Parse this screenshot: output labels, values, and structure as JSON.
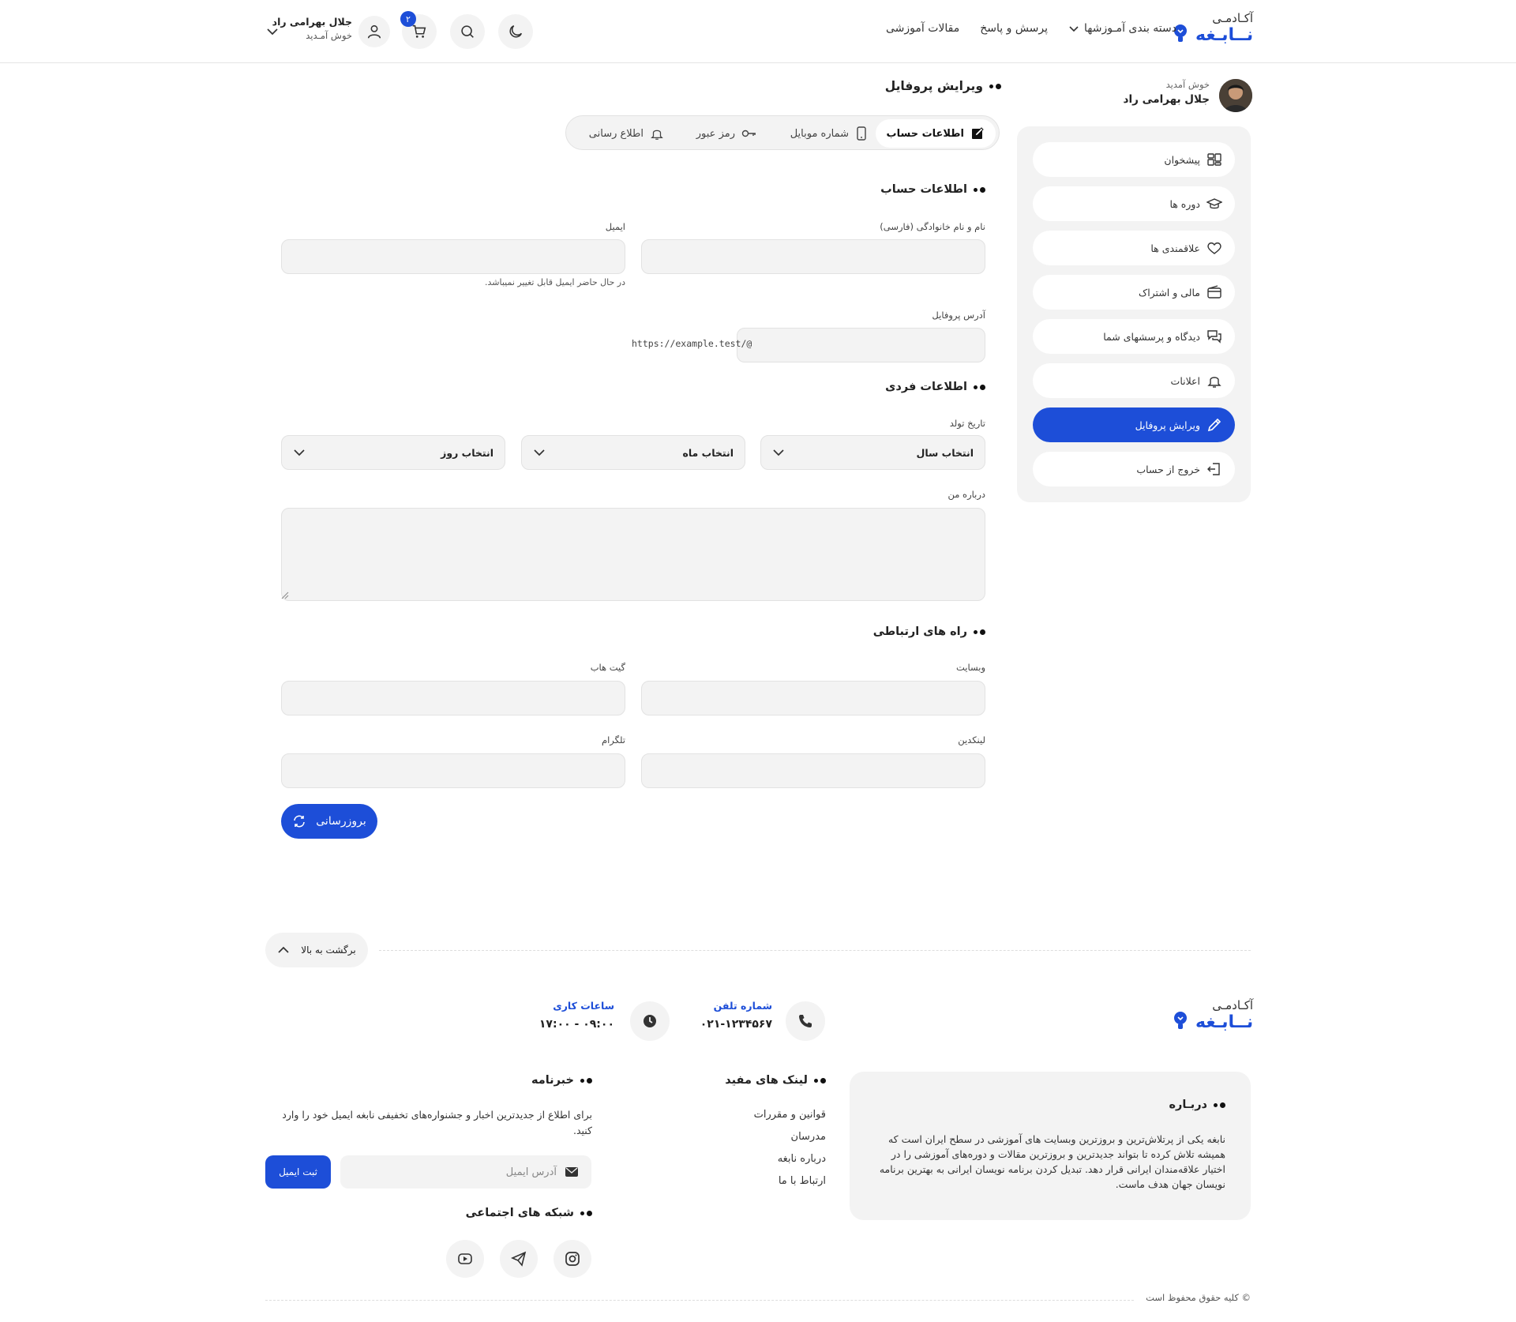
{
  "header": {
    "logo_top": "آکـادمـی",
    "logo_bottom": "نــابـغه",
    "nav": [
      "دسته بندی آمـوزشها",
      "پرسش و پاسخ",
      "مقالات آموزشی"
    ],
    "cart_count": "۲",
    "user_name": "جلال بهرامی راد",
    "user_welcome": "خوش آمـدید"
  },
  "sidebar": {
    "welcome": "خوش آمدید",
    "user_name": "جلال بهرامی راد",
    "items": [
      {
        "label": "پیشخوان",
        "icon": "dashboard-icon"
      },
      {
        "label": "دوره ها",
        "icon": "graduation-cap-icon"
      },
      {
        "label": "علاقمندی ها",
        "icon": "heart-icon"
      },
      {
        "label": "مالی و اشتراک",
        "icon": "wallet-icon"
      },
      {
        "label": "دیدگاه و پرسشهای شما",
        "icon": "comments-icon"
      },
      {
        "label": "اعلانات",
        "icon": "bell-icon"
      },
      {
        "label": "ویرایش پروفایل",
        "icon": "pencil-icon"
      },
      {
        "label": "خروج از حساب",
        "icon": "logout-icon"
      }
    ],
    "active_index": 6
  },
  "main": {
    "title": "ویرایش پروفایل",
    "tabs": [
      {
        "label": "اطلاعات حساب",
        "icon": "edit-square-icon"
      },
      {
        "label": "شماره موبایل",
        "icon": "mobile-icon"
      },
      {
        "label": "رمز عبور",
        "icon": "key-icon"
      },
      {
        "label": "اطلاع رسانی",
        "icon": "bell-icon"
      }
    ],
    "account_section": "اطلاعات حساب",
    "name_label": "نام و نام خانوادگی (فارسی)",
    "name_value": "",
    "email_label": "ایمیل",
    "email_value": "",
    "email_hint": "در حال حاضر ایمیل قابل تغییر نمیباشد.",
    "profile_url_label": "آدرس پروفایل",
    "profile_url_prefix": "https://example.test/@",
    "profile_url_value": "",
    "personal_section": "اطلاعات فردی",
    "birth_label": "تاریخ تولد",
    "year_select": "انتخاب سال",
    "month_select": "انتخاب ماه",
    "day_select": "انتخاب روز",
    "about_label": "درباره من",
    "about_value": "",
    "contact_section": "راه های ارتباطی",
    "website_label": "وبسایت",
    "github_label": "گیت هاب",
    "linkedin_label": "لینکدین",
    "telegram_label": "تلگرام",
    "update_button": "بروزرسانی"
  },
  "footer": {
    "back_to_top": "برگشت به بالا",
    "logo_top": "آکـادمـی",
    "logo_bottom": "نــابـغه",
    "phone_title": "شماره تلفن",
    "phone_value": "۰۲۱-۱۲۳۴۵۶۷",
    "hours_title": "ساعات کاری",
    "hours_value": "۰۹:۰۰ - ۱۷:۰۰",
    "about_title": "دربـاره",
    "about_text": "نابغه یکی از پرتلاش‌ترین و بروزترین وبسایت های آموزشی در سطح ایران است که همیشه تلاش کرده تا بتواند جدیدترین و بروزترین مقالات و دوره‌های آموزشی را در اختیار علاقه‌مندان ایرانی قرار دهد. تبدیل کردن برنامه نویسان ایرانی به بهترین برنامه نویسان جهان هدف ماست.",
    "links_title": "لینک های مفید",
    "links": [
      "قوانین و مقررات",
      "مدرسان",
      "درباره نابغه",
      "ارتباط با ما"
    ],
    "newsletter_title": "خبرنامه",
    "newsletter_text": "برای اطلاع از جدیدترین اخبار و جشنواره‌های تخفیفی نابغه ایمیل خود را وارد کنید.",
    "newsletter_placeholder": "آدرس ایمیل",
    "newsletter_button": "ثبت ایمیل",
    "social_title": "شبکه های اجتماعی",
    "copyright": "© کلیه حقوق محفوظ است"
  },
  "colors": {
    "accent": "#1d4ed8",
    "field_bg": "#f3f3f3"
  }
}
